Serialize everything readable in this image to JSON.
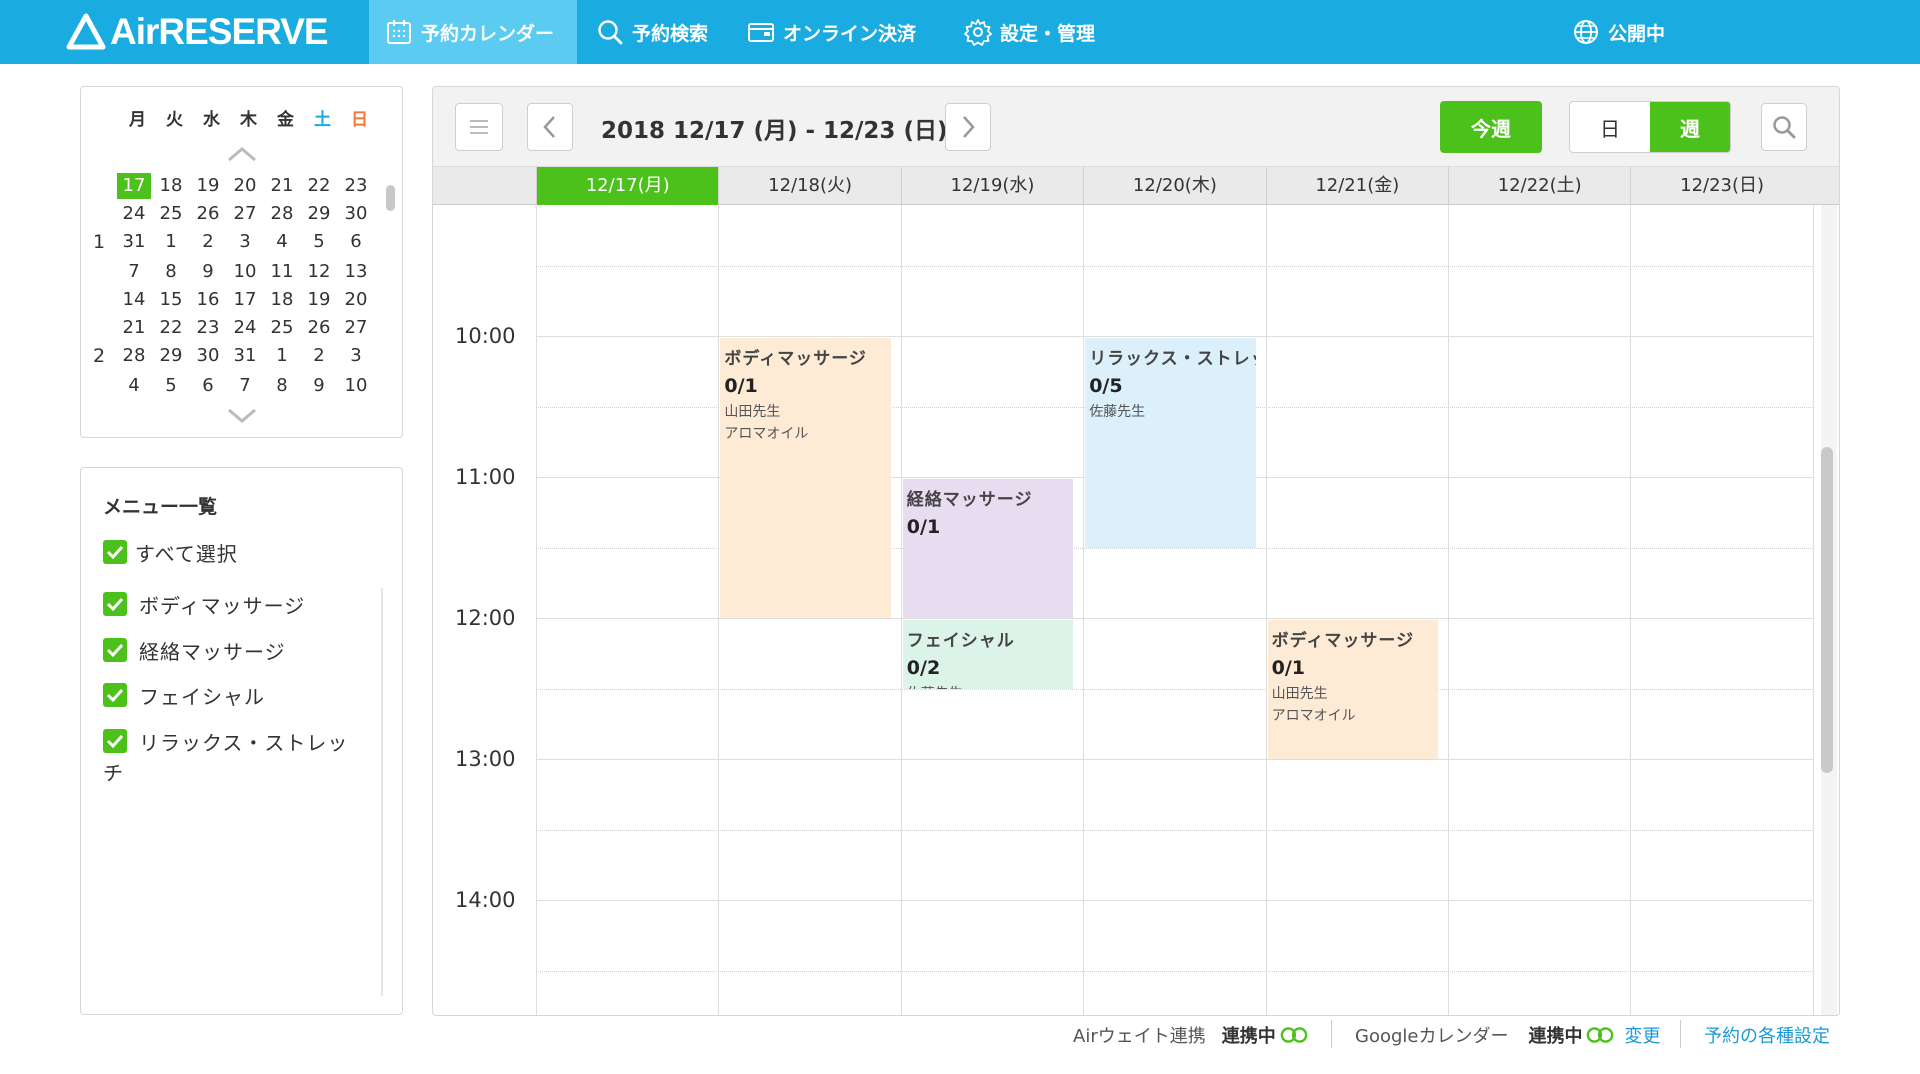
{
  "app": {
    "logo_text": "AirRESERVE"
  },
  "nav": {
    "items": [
      {
        "label": "予約カレンダー",
        "icon": "calendar-icon"
      },
      {
        "label": "予約検索",
        "icon": "search-icon"
      },
      {
        "label": "オンライン決済",
        "icon": "wallet-icon"
      },
      {
        "label": "設定・管理",
        "icon": "gear-icon"
      }
    ],
    "status": {
      "label": "公開中",
      "icon": "globe-icon"
    }
  },
  "mini_calendar": {
    "weekdays": [
      "月",
      "火",
      "水",
      "木",
      "金",
      "土",
      "日"
    ],
    "rows": [
      {
        "month": "",
        "days": [
          "17",
          "18",
          "19",
          "20",
          "21",
          "22",
          "23"
        ],
        "selected_index": 0
      },
      {
        "month": "",
        "days": [
          "24",
          "25",
          "26",
          "27",
          "28",
          "29",
          "30"
        ]
      },
      {
        "month": "1",
        "days": [
          "31",
          "1",
          "2",
          "3",
          "4",
          "5",
          "6"
        ]
      },
      {
        "month": "",
        "days": [
          "7",
          "8",
          "9",
          "10",
          "11",
          "12",
          "13"
        ]
      },
      {
        "month": "",
        "days": [
          "14",
          "15",
          "16",
          "17",
          "18",
          "19",
          "20"
        ]
      },
      {
        "month": "",
        "days": [
          "21",
          "22",
          "23",
          "24",
          "25",
          "26",
          "27"
        ]
      },
      {
        "month": "2",
        "days": [
          "28",
          "29",
          "30",
          "31",
          "1",
          "2",
          "3"
        ]
      },
      {
        "month": "",
        "days": [
          "4",
          "5",
          "6",
          "7",
          "8",
          "9",
          "10"
        ]
      }
    ]
  },
  "menu_list": {
    "title": "メニュー一覧",
    "select_all": "すべて選択",
    "items": [
      "ボディマッサージ",
      "経絡マッサージ",
      "フェイシャル",
      "リラックス・ストレッ",
      "チ"
    ]
  },
  "toolbar": {
    "range": "2018 12/17 (月) - 12/23 (日)",
    "today": "今週",
    "view_day": "日",
    "view_week": "週"
  },
  "days": [
    "12/17(月)",
    "12/18(火)",
    "12/19(水)",
    "12/20(木)",
    "12/21(金)",
    "12/22(土)",
    "12/23(日)"
  ],
  "times": [
    "10:00",
    "11:00",
    "12:00",
    "13:00",
    "14:00"
  ],
  "events": [
    {
      "title": "ボディマッサージ",
      "count": "0/1",
      "staff": "山田先生",
      "option": "アロマオイル",
      "color": "#fdebd6"
    },
    {
      "title": "経絡マッサージ",
      "count": "0/1",
      "staff": "",
      "option": "",
      "color": "#e8dcf0"
    },
    {
      "title": "フェイシャル",
      "count": "0/2",
      "staff": "佐藤先生",
      "option": "",
      "color": "#dcf3ea"
    },
    {
      "title": "リラックス・ストレッチ",
      "count": "0/5",
      "staff": "佐藤先生",
      "option": "",
      "color": "#dbf0fa"
    },
    {
      "title": "ボディマッサージ",
      "count": "0/1",
      "staff": "山田先生",
      "option": "アロマオイル",
      "color": "#fdebd6"
    }
  ],
  "footer": {
    "airwait": "Airウェイト連携",
    "airwait_status": "連携中",
    "google": "Googleカレンダー",
    "google_status": "連携中",
    "change": "変更",
    "settings": "予約の各種設定"
  }
}
